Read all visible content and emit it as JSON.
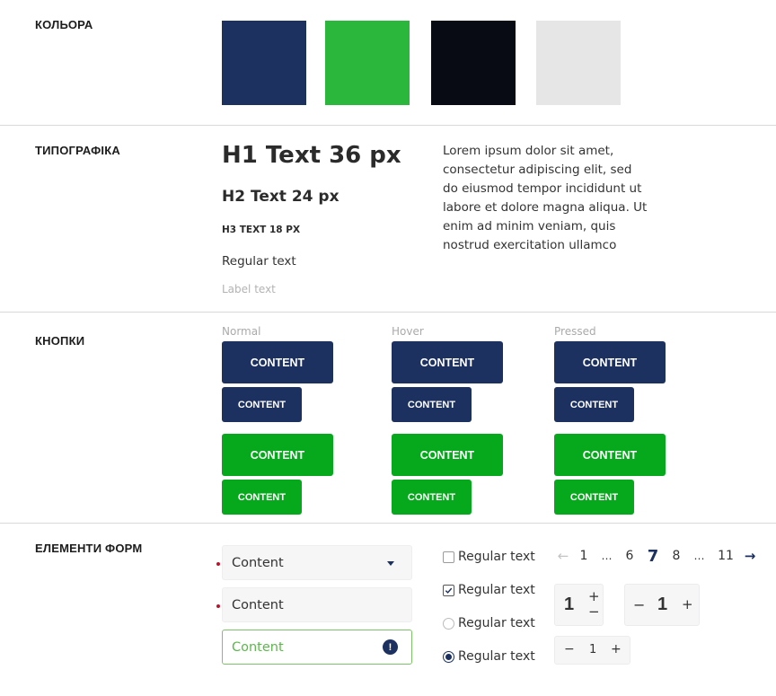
{
  "sections": {
    "colors": "КОЛЬОРА",
    "typography": "ТИПОГРАФІКА",
    "buttons": "КНОПКИ",
    "forms": "ЕЛЕМЕНТИ ФОРМ"
  },
  "palette": [
    {
      "name": "navy",
      "hex": "#1c3160"
    },
    {
      "name": "green",
      "hex": "#2ab73c"
    },
    {
      "name": "black",
      "hex": "#080b13"
    },
    {
      "name": "light-gray",
      "hex": "#e6e6e6"
    }
  ],
  "typography": {
    "h1": "H1 Text 36 px",
    "h2": "H2 Text 24 px",
    "h3": "H3 TEXT 18 PX",
    "regular": "Regular text",
    "label": "Label text",
    "lorem": "Lorem ipsum dolor sit amet, consectetur adipiscing elit, sed do eiusmod tempor incididunt ut labore et dolore magna aliqua. Ut enim ad minim veniam, quis nostrud exercitation ullamco"
  },
  "buttons": {
    "states": [
      "Normal",
      "Hover",
      "Pressed"
    ],
    "label": "CONTENT",
    "colors": {
      "primary": "#1c3160",
      "secondary": "#06a81c"
    }
  },
  "forms": {
    "select": {
      "value": "Content",
      "required": true
    },
    "input": {
      "value": "Content",
      "required": true
    },
    "input_success": {
      "value": "Content",
      "icon": "alert-icon"
    },
    "checkboxes": [
      {
        "label": "Regular text",
        "checked": false
      },
      {
        "label": "Regular text",
        "checked": true
      }
    ],
    "radios": [
      {
        "label": "Regular text",
        "selected": false
      },
      {
        "label": "Regular text",
        "selected": true
      }
    ],
    "pagination": {
      "prev": "←",
      "next": "→",
      "items": [
        "1",
        "…",
        "6",
        "7",
        "8",
        "…",
        "11"
      ],
      "current": "7"
    },
    "steppers": [
      {
        "value": "1",
        "plus": "+",
        "minus": "−"
      },
      {
        "value": "1",
        "plus": "+",
        "minus": "−"
      },
      {
        "value": "1",
        "plus": "+",
        "minus": "−"
      }
    ]
  }
}
